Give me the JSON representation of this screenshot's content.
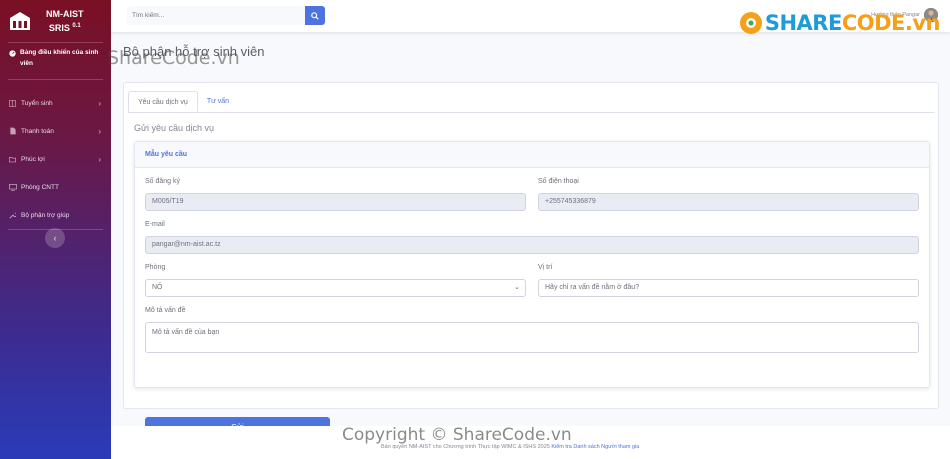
{
  "brand": {
    "name": "NM-AIST",
    "sub": "SRIS",
    "version": "0.1"
  },
  "sidebar": {
    "dashboard": "Bảng điều khiển của sinh viên",
    "items": [
      {
        "label": "Tuyển sinh",
        "icon": "columns-icon",
        "chevron": true
      },
      {
        "label": "Thanh toán",
        "icon": "file-icon",
        "chevron": true
      },
      {
        "label": "Phúc lợi",
        "icon": "folder-icon",
        "chevron": true
      },
      {
        "label": "Phòng CNTT",
        "icon": "monitor-icon",
        "chevron": false
      },
      {
        "label": "Bộ phận trợ giúp",
        "icon": "wrench-icon",
        "chevron": false
      }
    ],
    "toggle": "‹"
  },
  "topbar": {
    "search_placeholder": "Tìm kiếm...",
    "user_name": "Hướng thảo Pangar"
  },
  "watermark": {
    "logo_share": "SHARE",
    "logo_code": "CODE.vn",
    "overlay": "ShareCode.vn",
    "copyright": "Copyright © ShareCode.vn"
  },
  "page": {
    "title": "Bộ phận hỗ trợ sinh viên",
    "tabs": [
      "Yêu cầu dịch vụ",
      "Tư vấn"
    ],
    "section_title": "Gửi yêu cầu dịch vụ",
    "form": {
      "header": "Mẫu yêu cầu",
      "reg_label": "Số đăng ký",
      "reg_value": "M005/T19",
      "phone_label": "Số điện thoại",
      "phone_value": "+255745336879",
      "email_label": "E-mail",
      "email_value": "pangar@nm-aist.ac.tz",
      "room_label": "Phòng",
      "room_value": "NỎ",
      "location_label": "Vị trí",
      "location_placeholder": "Hãy chỉ ra vấn đề nằm ở đâu?",
      "desc_label": "Mô tả vấn đề",
      "desc_placeholder": "Mô tả vấn đề của bạn",
      "submit": "Gửi"
    }
  },
  "footer": {
    "text": "Bản quyền NM-AIST cho Chương trình Thực tập WIMC & ISHS 2025",
    "link": "Kiểm tra Danh sách Người tham gia"
  }
}
